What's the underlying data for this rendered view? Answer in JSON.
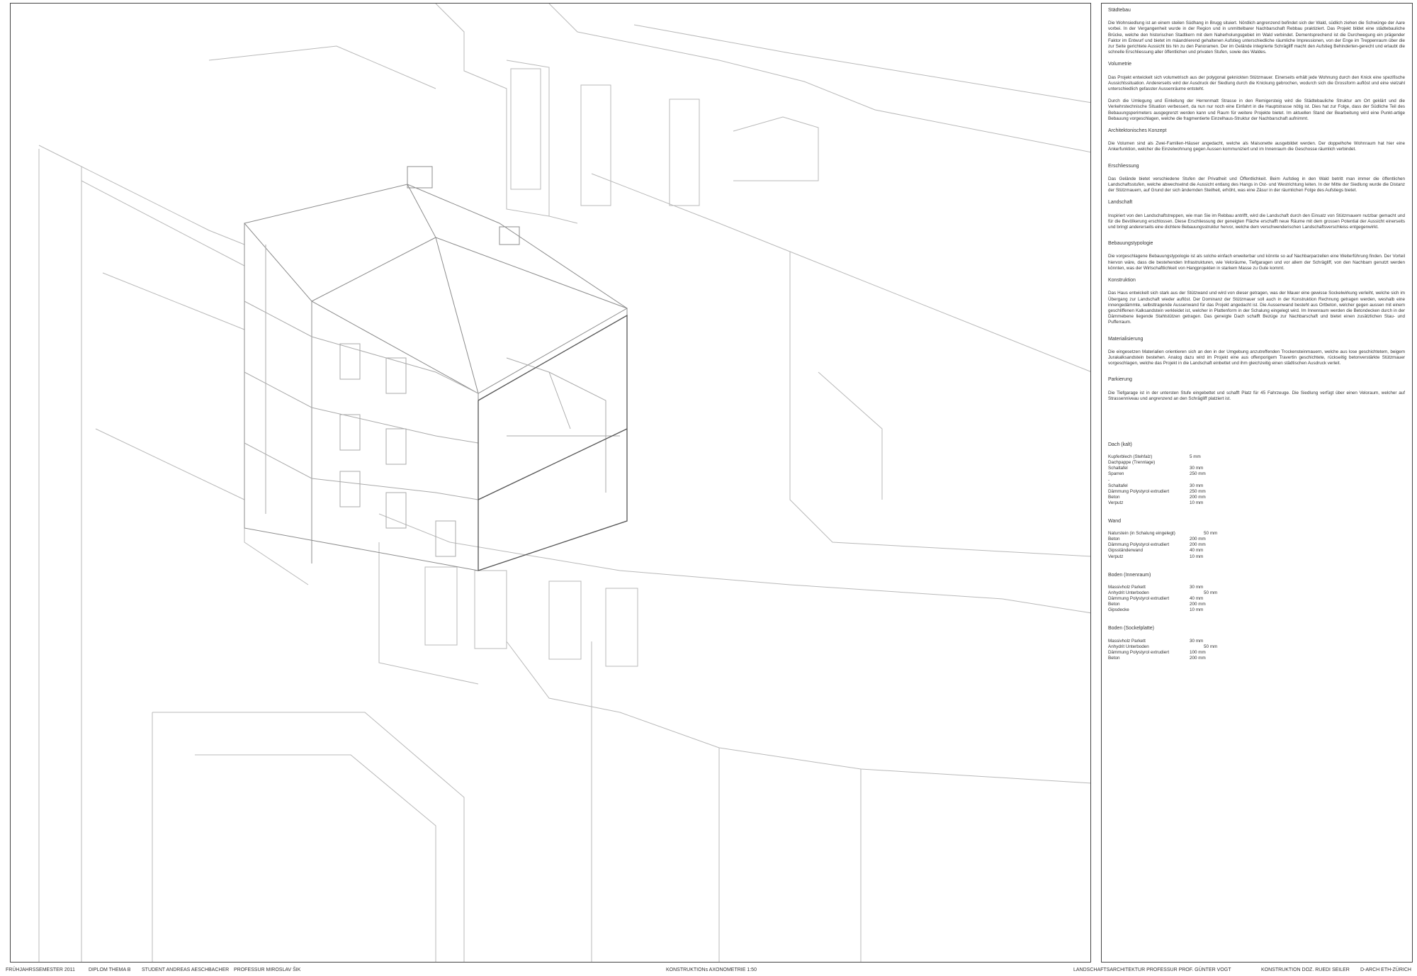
{
  "footer": {
    "semester": "FRÜHJAHRSSEMESTER 2011",
    "diplom": "DIPLOM THEMA B",
    "student": "STUDENT ANDREAS AESCHBACHER",
    "professor": "PROFESSUR MIROSLAV ŠIK",
    "drawing_title": "KONSTRUKTIONs AXONOMETRIE 1:50",
    "landscape": "LANDSCHAFTSARCHITEKTUR PROFESSUR PROF. GÜNTER VOGT",
    "construction": "KONSTRUKTION DOZ. RUEDI SEILER",
    "institution": "D-ARCH ETH-ZÜRICH"
  },
  "sections": [
    {
      "title": "Städtebau",
      "paragraphs": [
        "Die Wohnsiedlung ist an einem steilen Südhang in Brugg situiert. Nördlich angrenzend befindet sich der Wald, südlich ziehen die Schwünge der Aare vorbei. In der Vergangenheit wurde in der Region und in unmittelbarer Nachbarschaft Rebbau praktiziert. Das Projekt bildet eine städtebauliche Brücke, welche den historischen Stadtkern mit dem Naherholungsgebiet im Wald verbindet. Dementsprechend ist die Durchwegung ein prägender Faktor im Entwurf und bietet im mäandrierend gehaltenen Aufstieg unterschiedliche räumliche Impressionen, von der Enge im Treppenraum über die zur Seite gerichtete Aussicht bis hin zu den Panoramen. Der im Gelände integrierte Schrägliff macht den Aufstieg Behinderten-gerecht und erlaubt die schnelle Erschliessung aller öffentlichen und privaten Stufen, sowie des Waldes."
      ]
    },
    {
      "title": "Volumetrie",
      "paragraphs": [
        "Das Projekt entwickelt sich volumetrisch aus der polygonal geknickten Stützmauer. Einerseits erhält jede Wohnung durch den Knick eine spezifische Aussichtssituation. Andererseits wird der Ausdruck der Siedlung durch die Knickung gebrochen, wodurch sich die Grossform auflöst und eine vielzahl unterschiedlich gefasster Aussenräume entsteht.",
        "Durch die Umlegung und Einleitung der Herrenmatt Strasse in den Remigersteig wird die Städtebauliche Struktur am Ort geklärt und die Verkehrstechnische Situation verbessert, da nun nur noch eine Einfahrt in die Hauptstrasse nötig ist. Dies hat zur Folge, dass der Südliche Teil des Bebauungsperimeters ausgegrenzt werden kann und Raum für weitere Projekte bietet. Im aktuellen Stand der Bearbeitung wird eine Punkt-artige Bebauung vorgeschlagen, welche die fragmentierte Einzelhaus-Struktur der Nachbarschaft aufnimmt."
      ]
    },
    {
      "title": "Architektonisches Konzept",
      "paragraphs": [
        "Die Volumen sind als Zwei-Familien-Häuser angedacht, welche als Maisonette ausgebildet werden. Der doppelhohe Wohnraum hat hier eine Ankerfunktion, welcher die Einzelwohnung gegen Aussen kommuniziert und im Innenraum die Geschosse räumlich verbindet."
      ]
    },
    {
      "title": "Erschliessung",
      "gap": true,
      "paragraphs": [
        "Das Gelände bietet verschiedene Stufen der Privatheit und Öffentlichkeit. Beim Aufstieg in den Wald betritt man immer die öffentlichen Landschaftsstufen, welche abwechselnd die Aussicht entlang des Hangs in Ost- und Westrichtung leiten. In der Mitte der Siedlung wurde die Distanz der Stützmauern, auf Grund der sich ändernden Steilheit, erhöht, was eine Zäsur in der räumlichen Folge des Aufstiegs bietet."
      ]
    },
    {
      "title": "Landschaft",
      "paragraphs": [
        "Inspiriert von den Landschaftstreppen, wie man Sie im Rebbau antrifft, wird die Landschaft durch den Einsatz von Stützmauern nutzbar gemacht und für die Bevölkerung erschlossen. Diese Erschliessung der geneigten Fläche erschafft neue Räume mit dem grossen Potential der Aussicht einerseits und bringt andererseits eine dichtere Bebauungsstruktur hervor, welche dem verschwenderischen Landschaftsverschleiss entgegenwirkt."
      ]
    },
    {
      "title": "Bebauungstypologie",
      "gap": true,
      "paragraphs": [
        "Die vorgeschlagene Bebauungstypologie ist als solche einfach erweiterbar und könnte so auf Nachbarparzellen eine Weiterführung finden. Der Vorteil hiervon wäre, dass die bestehenden Infrastrukturen, wie Veloräume, Tiefgaragen und vor allem der Schrägliff, von den Nachbarn genutzt werden könnten, was der Wirtschaftlichkeit von Hangprojekten in starkem Masse zu Gute kommt."
      ]
    },
    {
      "title": "Konstruktion",
      "paragraphs": [
        "Das Haus entwickelt sich stark aus der Stützwand und wird von dieser getragen, was der Mauer eine gewisse Sockelwirkung verleiht, welche sich im Übergang zur Landschaft wieder auflöst. Der Dominanz der Stützmauer soll auch in der Konstruktion Rechnung getragen werden, weshalb eine innengedämmte, selbsttragende Aussenwand für das Projekt angedacht ist. Die Aussenwand besteht aus Ortbeton, welcher gegen aussen mit einem geschliffenen Kalksandstein verkleidet ist, welcher in Plattenform in der Schalung eingelegt wird. Im Innenraum werden die Betondecken durch in der Dämmebene liegende Stahlstützen getragen. Das geneigte Dach schafft Bezüge zur Nachbarschaft und bietet einen zusätzlichen Stau- und Pufferraum."
      ]
    },
    {
      "title": "Materialisierung",
      "gap": true,
      "paragraphs": [
        "Die eingesetzen Materialien orientieren sich an den in der Umgebung anzutreffenden Trockensteinmauern, welche aus lose geschichtetem, beigem Jurakalksandstein bestehen.  Analog dazu wird im Projekt eine aus offenporigem Travertin geschichtete, rückseitig betonverstärkte Stützmauer vorgeschlagen, welche das Projekt in die Landschaft einbettet und ihm gleichzeitig einen städtischen Ausdruck verleit."
      ]
    },
    {
      "title": "Parkierung",
      "gap": true,
      "paragraphs": [
        "Die Tiefgarage ist in der untersten Stufe eingebettet und schafft Platz für 45 Fahrzeuge. Die Siedlung verfügt über einen Veloraum, welcher auf Strassenniveau und angrenzend an den Schrägliff platziert ist."
      ]
    }
  ],
  "materials": [
    {
      "title": "Dach (kalt)",
      "rows": [
        {
          "name": "Kupferblech (Stehfalz)",
          "value": "5 mm"
        },
        {
          "name": "Dachpappe (Trennlage)",
          "value": ""
        },
        {
          "name": "Schaltafel",
          "value": "30 mm"
        },
        {
          "name": "Sparren",
          "value": "250 mm"
        },
        {
          "name": "-",
          "value": ""
        },
        {
          "name": "Schaltafel",
          "value": "30 mm"
        },
        {
          "name": "Dämmung Polystyrol extrudiert",
          "value": "250 mm"
        },
        {
          "name": "Beton",
          "value": "200 mm"
        },
        {
          "name": "Verputz",
          "value": "10 mm"
        }
      ]
    },
    {
      "title": "Wand",
      "rows": [
        {
          "name": "Naturstein (in Schalung eingelegt)",
          "value": "50 mm",
          "offset": true
        },
        {
          "name": "Beton",
          "value": "200 mm"
        },
        {
          "name": "Dämmung Polystyrol extrudiert",
          "value": "200 mm"
        },
        {
          "name": "Gipsständerwand",
          "value": "40 mm"
        },
        {
          "name": "Verputz",
          "value": "10 mm"
        }
      ]
    },
    {
      "title": "Boden (Innenraum)",
      "rows": [
        {
          "name": "Massivholz Parkett",
          "value": "30 mm"
        },
        {
          "name": "Anhydrit Unterboden",
          "value": "50 mm",
          "offset": true
        },
        {
          "name": "Dämmung Polystyrol extrudiert",
          "value": "40 mm"
        },
        {
          "name": "Beton",
          "value": "200 mm"
        },
        {
          "name": "Gipsdecke",
          "value": "10 mm"
        }
      ]
    },
    {
      "title": "Boden (Sockelplatte)",
      "rows": [
        {
          "name": "Massivholz Parkett",
          "value": "30 mm"
        },
        {
          "name": "Anhydrit Unterboden",
          "value": "50 mm",
          "offset": true
        },
        {
          "name": "Dämmung Polystyrol extrudiert",
          "value": "100 mm"
        },
        {
          "name": "Beton",
          "value": "200 mm"
        }
      ]
    }
  ]
}
